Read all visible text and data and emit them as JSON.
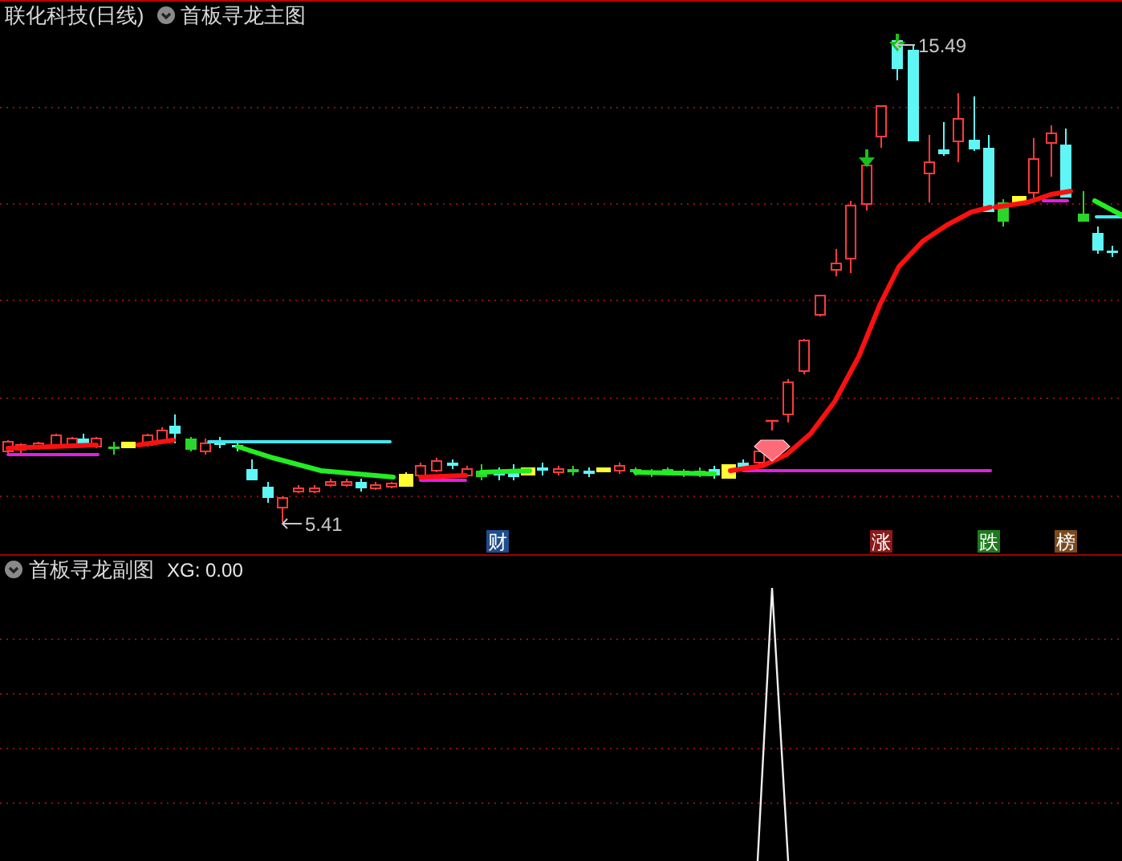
{
  "header": {
    "title": "联化科技(日线)",
    "indicator": "首板寻龙主图"
  },
  "main_chart": {
    "price_labels": [
      {
        "kind": "high",
        "text": "15.49"
      },
      {
        "kind": "low",
        "text": "5.41"
      }
    ],
    "badges": [
      {
        "text": "财",
        "color": "#1f4e8c"
      },
      {
        "text": "涨",
        "color": "#8b1a1a"
      },
      {
        "text": "跌",
        "color": "#1e7a1e"
      },
      {
        "text": "榜",
        "color": "#7a4a1e"
      }
    ]
  },
  "sub_panel": {
    "title": "首板寻龙副图",
    "reading": "XG: 0.00"
  }
}
